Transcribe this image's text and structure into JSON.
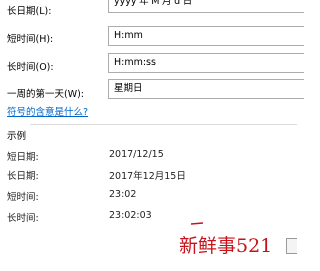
{
  "settings": {
    "long_date_label": "长日期(L):",
    "long_date_value": "yyyy'年'M'月'd'日'",
    "short_time_label": "短时间(H):",
    "short_time_value": "H:mm",
    "long_time_label": "长时间(O):",
    "long_time_value": "H:mm:ss",
    "first_day_label": "一周的第一天(W):",
    "first_day_value": "星期日",
    "symbols_help_link": "符号的含意是什么?"
  },
  "examples": {
    "heading": "示例",
    "rows": [
      {
        "label": "短日期:",
        "value": "2017/12/15"
      },
      {
        "label": "长日期:",
        "value": "2017年12月15日"
      },
      {
        "label": "短时间:",
        "value": "23:02"
      },
      {
        "label": "长时间:",
        "value": "23:02:03"
      }
    ]
  },
  "watermark": {
    "text": "新鲜事521",
    "color": "#c6131b"
  }
}
